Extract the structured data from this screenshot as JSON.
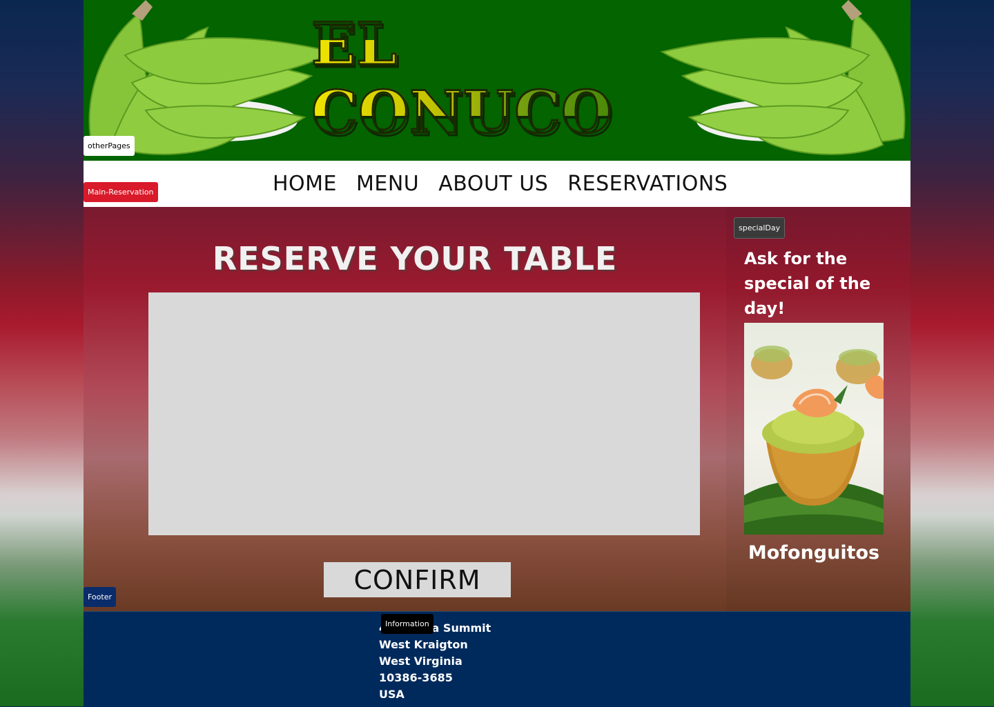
{
  "header": {
    "logo_text": "EL CONUCO",
    "background_color": "#036400"
  },
  "tags": {
    "other_pages": "otherPages",
    "main_reservation": "Main-Reservation",
    "special_day": "specialDay",
    "footer": "Footer",
    "information": "Information"
  },
  "nav": {
    "items": [
      {
        "label": "HOME"
      },
      {
        "label": "MENU"
      },
      {
        "label": "ABOUT US"
      },
      {
        "label": "RESERVATIONS"
      }
    ]
  },
  "main": {
    "title": "RESERVE YOUR TABLE",
    "confirm_label": "CONFIRM"
  },
  "special": {
    "text": "Ask for the special of the day!",
    "dish_name": "Mofonguitos"
  },
  "footer": {
    "address_lines": [
      "4 Chelsea Summit",
      "West Kraigton",
      "West Virginia",
      "10386-3685",
      "USA"
    ]
  },
  "colors": {
    "nav_background": "#ffffff",
    "footer_background": "#002a5c",
    "reservation_box": "#d9d9d9",
    "main_reservation_tag": "#d91a2a"
  }
}
